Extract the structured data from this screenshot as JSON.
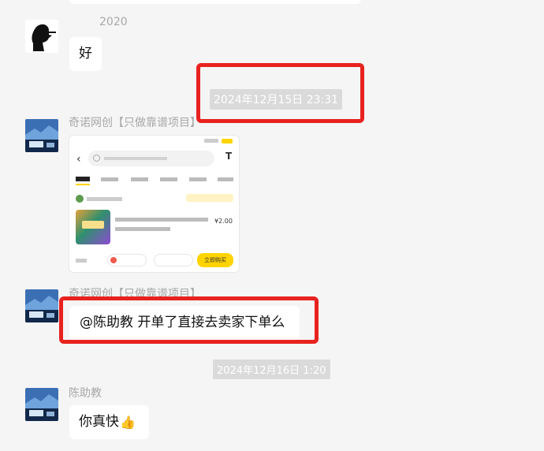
{
  "top_fragment_year": "2020",
  "messages": {
    "m1": {
      "text": "好"
    },
    "ts1": "2024年12月15日 23:31",
    "m2": {
      "sender": "奇诺网创【只做靠谱项目】",
      "card": {
        "price": "¥2.00",
        "action": "立即购买"
      }
    },
    "m3": {
      "sender": "奇诺网创【只做靠谱项目】",
      "text": "@陈助教 开单了直接去卖家下单么"
    },
    "ts2": "2024年12月16日 1:20",
    "m4": {
      "sender": "陈助教",
      "text": "你真快",
      "emoji": "👍"
    }
  },
  "colors": {
    "background": "#f5f5f5",
    "bubble": "#ffffff",
    "highlight_box": "#e8221f",
    "timestamp_chip": "#dadada",
    "sender_name": "#a8a8a8",
    "card_button_yellow": "#ffd400"
  },
  "icons": [
    "smoker-silhouette-avatar",
    "landscape-avatar",
    "thumbs-up-emoji"
  ]
}
